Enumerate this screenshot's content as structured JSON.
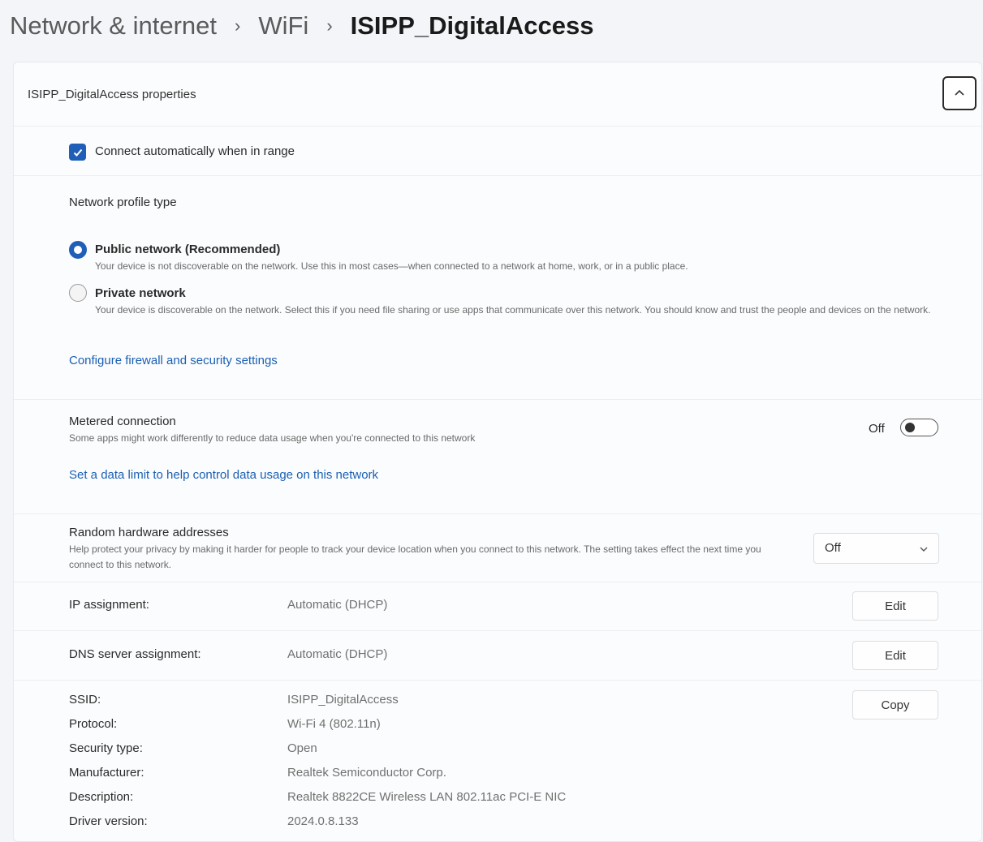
{
  "breadcrumb": {
    "items": [
      "Network & internet",
      "WiFi"
    ],
    "current": "ISIPP_DigitalAccess",
    "separator": "›"
  },
  "properties": {
    "title": "ISIPP_DigitalAccess properties",
    "collapse_icon": "chevron-up-icon",
    "connect_auto": {
      "label": "Connect automatically when in range",
      "checked": true
    },
    "profile": {
      "heading": "Network profile type",
      "options": [
        {
          "label": "Public network (Recommended)",
          "selected": true,
          "desc": "Your device is not discoverable on the network. Use this in most cases—when connected to a network at home, work, or in a public place."
        },
        {
          "label": "Private network",
          "selected": false,
          "desc": "Your device is discoverable on the network. Select this if you need file sharing or use apps that communicate over this network. You should know and trust the people and devices on the network."
        }
      ],
      "firewall_link": "Configure firewall and security settings"
    },
    "metered": {
      "title": "Metered connection",
      "desc": "Some apps might work differently to reduce data usage when you're connected to this network",
      "state": "Off",
      "data_limit_link": "Set a data limit to help control data usage on this network"
    },
    "random_hw": {
      "title": "Random hardware addresses",
      "desc": "Help protect your privacy by making it harder for people to track your device location when you connect to this network. The setting takes effect the next time you connect to this network.",
      "value": "Off"
    },
    "ip": {
      "label": "IP assignment:",
      "value": "Automatic (DHCP)",
      "button": "Edit"
    },
    "dns": {
      "label": "DNS server assignment:",
      "value": "Automatic (DHCP)",
      "button": "Edit"
    },
    "details": {
      "copy_button": "Copy",
      "rows": [
        {
          "key": "SSID:",
          "value": "ISIPP_DigitalAccess"
        },
        {
          "key": "Protocol:",
          "value": "Wi-Fi 4 (802.11n)"
        },
        {
          "key": "Security type:",
          "value": "Open"
        },
        {
          "key": "Manufacturer:",
          "value": "Realtek Semiconductor Corp."
        },
        {
          "key": "Description:",
          "value": "Realtek 8822CE Wireless LAN 802.11ac PCI-E NIC"
        },
        {
          "key": "Driver version:",
          "value": "2024.0.8.133"
        }
      ]
    }
  },
  "colors": {
    "accent": "#1f5fb8",
    "link": "#1a5fb4"
  }
}
